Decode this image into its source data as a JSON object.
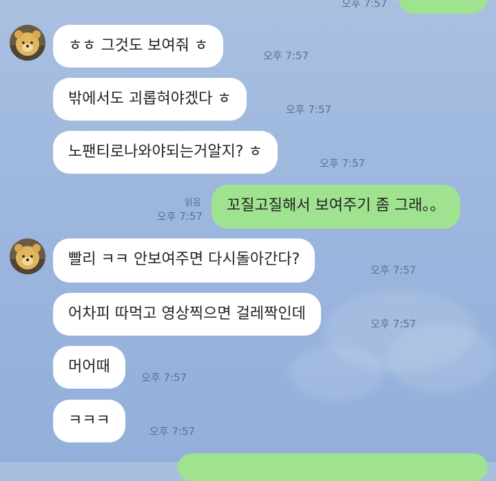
{
  "chat": {
    "top_partial": {
      "time": "오후 7:57"
    },
    "groups": [
      {
        "sender": "other",
        "avatar_icon": "bear-plush-avatar-icon",
        "messages": [
          {
            "text": "ㅎㅎ 그것도 보여줘 ㅎ",
            "time": "오후 7:57"
          },
          {
            "text": "밖에서도 괴롭혀야겠다 ㅎ",
            "time": "오후 7:57"
          },
          {
            "text": "노팬티로나와야되는거알지? ㅎ",
            "time": "오후 7:57"
          }
        ]
      },
      {
        "sender": "me",
        "messages": [
          {
            "text": "꼬질고질해서 보여주기 좀 그래。。",
            "time": "오후 7:57",
            "read": "읽음"
          }
        ]
      },
      {
        "sender": "other",
        "avatar_icon": "bear-plush-avatar-icon",
        "messages": [
          {
            "text": "빨리 ㅋㅋ 안보여주면 다시돌아간다?",
            "time": "오후 7:57"
          },
          {
            "text": "어차피 따먹고 영상찍으면 걸레짝인데",
            "time": "오후 7:57"
          },
          {
            "text": "머어때",
            "time": "오후 7:57"
          },
          {
            "text": "ㅋㅋㅋ",
            "time": "오후 7:57"
          }
        ]
      }
    ]
  },
  "colors": {
    "background": "#a7bfdf",
    "bubble_other": "#ffffff",
    "bubble_me": "#9fe28f",
    "meta_text": "#5d7090"
  }
}
